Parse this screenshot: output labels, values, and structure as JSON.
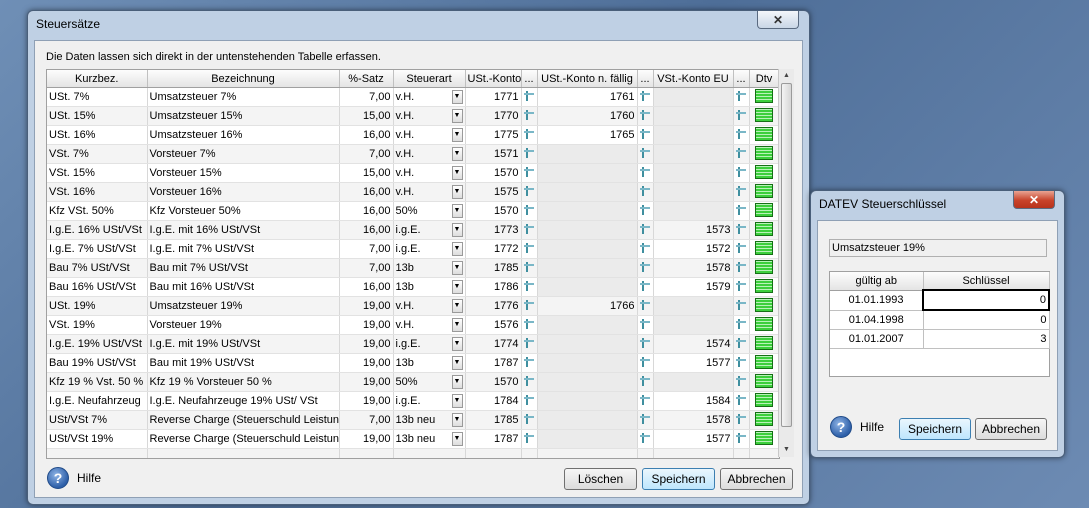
{
  "main": {
    "title": "Steuersätze",
    "instruction": "Die Daten lassen sich direkt in der untenstehenden Tabelle erfassen.",
    "columns": [
      "Kurzbez.",
      "Bezeichnung",
      "%-Satz",
      "Steuerart",
      "USt.-Konto",
      "...",
      "USt.-Konto n. fällig",
      "...",
      "VSt.-Konto EU",
      "...",
      "Dtv"
    ],
    "rows": [
      {
        "kurz": "USt. 7%",
        "bez": "Umsatzsteuer 7%",
        "satz": "7,00",
        "art": "v.H.",
        "ust": "1771",
        "nf": "1761",
        "eu": ""
      },
      {
        "kurz": "USt. 15%",
        "bez": "Umsatzsteuer 15%",
        "satz": "15,00",
        "art": "v.H.",
        "ust": "1770",
        "nf": "1760",
        "eu": ""
      },
      {
        "kurz": "USt. 16%",
        "bez": "Umsatzsteuer 16%",
        "satz": "16,00",
        "art": "v.H.",
        "ust": "1775",
        "nf": "1765",
        "eu": ""
      },
      {
        "kurz": "VSt. 7%",
        "bez": "Vorsteuer 7%",
        "satz": "7,00",
        "art": "v.H.",
        "ust": "1571",
        "nf": "",
        "eu": ""
      },
      {
        "kurz": "VSt. 15%",
        "bez": "Vorsteuer 15%",
        "satz": "15,00",
        "art": "v.H.",
        "ust": "1570",
        "nf": "",
        "eu": ""
      },
      {
        "kurz": "VSt. 16%",
        "bez": "Vorsteuer 16%",
        "satz": "16,00",
        "art": "v.H.",
        "ust": "1575",
        "nf": "",
        "eu": ""
      },
      {
        "kurz": "Kfz VSt. 50%",
        "bez": "Kfz Vorsteuer 50%",
        "satz": "16,00",
        "art": "50%",
        "ust": "1570",
        "nf": "",
        "eu": ""
      },
      {
        "kurz": "I.g.E. 16% USt/VSt",
        "bez": "I.g.E. mit 16% USt/VSt",
        "satz": "16,00",
        "art": "i.g.E.",
        "ust": "1773",
        "nf": "",
        "eu": "1573"
      },
      {
        "kurz": "I.g.E. 7% USt/VSt",
        "bez": "I.g.E. mit 7% USt/VSt",
        "satz": "7,00",
        "art": "i.g.E.",
        "ust": "1772",
        "nf": "",
        "eu": "1572"
      },
      {
        "kurz": "Bau 7% USt/VSt",
        "bez": "Bau mit 7% USt/VSt",
        "satz": "7,00",
        "art": "13b",
        "ust": "1785",
        "nf": "",
        "eu": "1578"
      },
      {
        "kurz": "Bau 16% USt/VSt",
        "bez": "Bau mit 16% USt/VSt",
        "satz": "16,00",
        "art": "13b",
        "ust": "1786",
        "nf": "",
        "eu": "1579"
      },
      {
        "kurz": "USt. 19%",
        "bez": "Umsatzsteuer 19%",
        "satz": "19,00",
        "art": "v.H.",
        "ust": "1776",
        "nf": "1766",
        "eu": ""
      },
      {
        "kurz": "VSt. 19%",
        "bez": "Vorsteuer 19%",
        "satz": "19,00",
        "art": "v.H.",
        "ust": "1576",
        "nf": "",
        "eu": ""
      },
      {
        "kurz": "I.g.E. 19% USt/VSt",
        "bez": "I.g.E. mit 19% USt/VSt",
        "satz": "19,00",
        "art": "i.g.E.",
        "ust": "1774",
        "nf": "",
        "eu": "1574"
      },
      {
        "kurz": "Bau 19% USt/VSt",
        "bez": "Bau mit 19% USt/VSt",
        "satz": "19,00",
        "art": "13b",
        "ust": "1787",
        "nf": "",
        "eu": "1577"
      },
      {
        "kurz": "Kfz 19 % Vst. 50 %",
        "bez": "Kfz 19 % Vorsteuer 50 %",
        "satz": "19,00",
        "art": "50%",
        "ust": "1570",
        "nf": "",
        "eu": ""
      },
      {
        "kurz": "I.g.E. Neufahrzeug",
        "bez": "I.g.E. Neufahrzeuge 19% USt/ VSt",
        "satz": "19,00",
        "art": "i.g.E.",
        "ust": "1784",
        "nf": "",
        "eu": "1584"
      },
      {
        "kurz": "USt/VSt 7%",
        "bez": "Reverse Charge (Steuerschuld Leistung",
        "satz": "7,00",
        "art": "13b neu",
        "ust": "1785",
        "nf": "",
        "eu": "1578"
      },
      {
        "kurz": "USt/VSt 19%",
        "bez": "Reverse Charge (Steuerschuld Leistung",
        "satz": "19,00",
        "art": "13b neu",
        "ust": "1787",
        "nf": "",
        "eu": "1577"
      }
    ],
    "help_label": "Hilfe",
    "delete_label": "Löschen",
    "save_label": "Speichern",
    "cancel_label": "Abbrechen"
  },
  "datev": {
    "title": "DATEV Steuerschlüssel",
    "tax_field": "Umsatzsteuer 19%",
    "columns": [
      "gültig ab",
      "Schlüssel"
    ],
    "rows": [
      {
        "date": "01.01.1993",
        "key": "0"
      },
      {
        "date": "01.04.1998",
        "key": "0"
      },
      {
        "date": "01.01.2007",
        "key": "3"
      }
    ],
    "help_label": "Hilfe",
    "save_label": "Speichern",
    "cancel_label": "Abbrechen"
  },
  "icons": [
    "close-icon",
    "help-icon",
    "picker-icon",
    "datev-icon",
    "dropdown-arrow-icon"
  ]
}
